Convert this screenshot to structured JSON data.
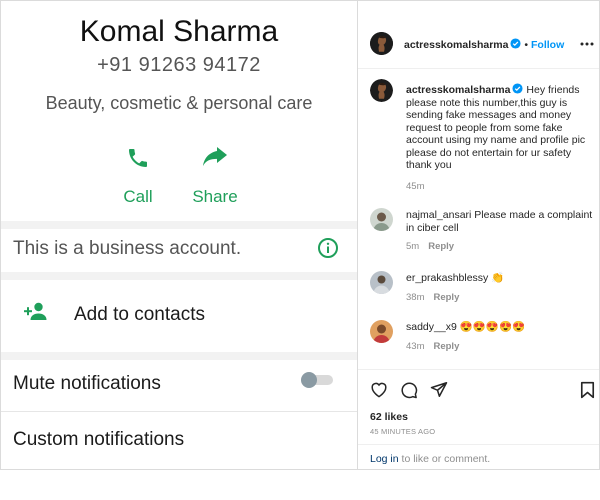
{
  "contact": {
    "name": "Komal Sharma",
    "phone": "+91 91263 94172",
    "category": "Beauty, cosmetic & personal care",
    "actions": [
      {
        "label": "Call",
        "icon": "phone-icon"
      },
      {
        "label": "Share",
        "icon": "share-arrow-icon"
      }
    ],
    "business_notice": "This is a business account.",
    "add_contacts_label": "Add to contacts",
    "mute_label": "Mute notifications",
    "mute_enabled": false,
    "custom_label": "Custom notifications"
  },
  "post": {
    "header": {
      "username": "actresskomalsharma",
      "follow_label": "Follow"
    },
    "caption": {
      "username": "actresskomalsharma",
      "text": "Hey friends please note this number,this guy is sending fake messages and money request to people from some fake account using my name and profile pic please do not entertain for ur safety thank you",
      "time": "45m"
    },
    "comments": [
      {
        "username": "najmal_ansari",
        "text": "Please made a complaint in ciber cell",
        "time": "5m",
        "reply_label": "Reply"
      },
      {
        "username": "er_prakashblessy",
        "text": "👏",
        "time": "38m",
        "reply_label": "Reply"
      },
      {
        "username": "saddy__x9",
        "text": "😍😍😍😍😍",
        "time": "43m",
        "reply_label": "Reply"
      }
    ],
    "likes": "62 likes",
    "timestamp": "45 MINUTES AGO",
    "login_link": "Log in",
    "login_suffix": " to like or comment."
  },
  "colors": {
    "whatsapp_green": "#1f9f5a",
    "instagram_blue": "#0095f6",
    "link_blue": "#00376b"
  }
}
